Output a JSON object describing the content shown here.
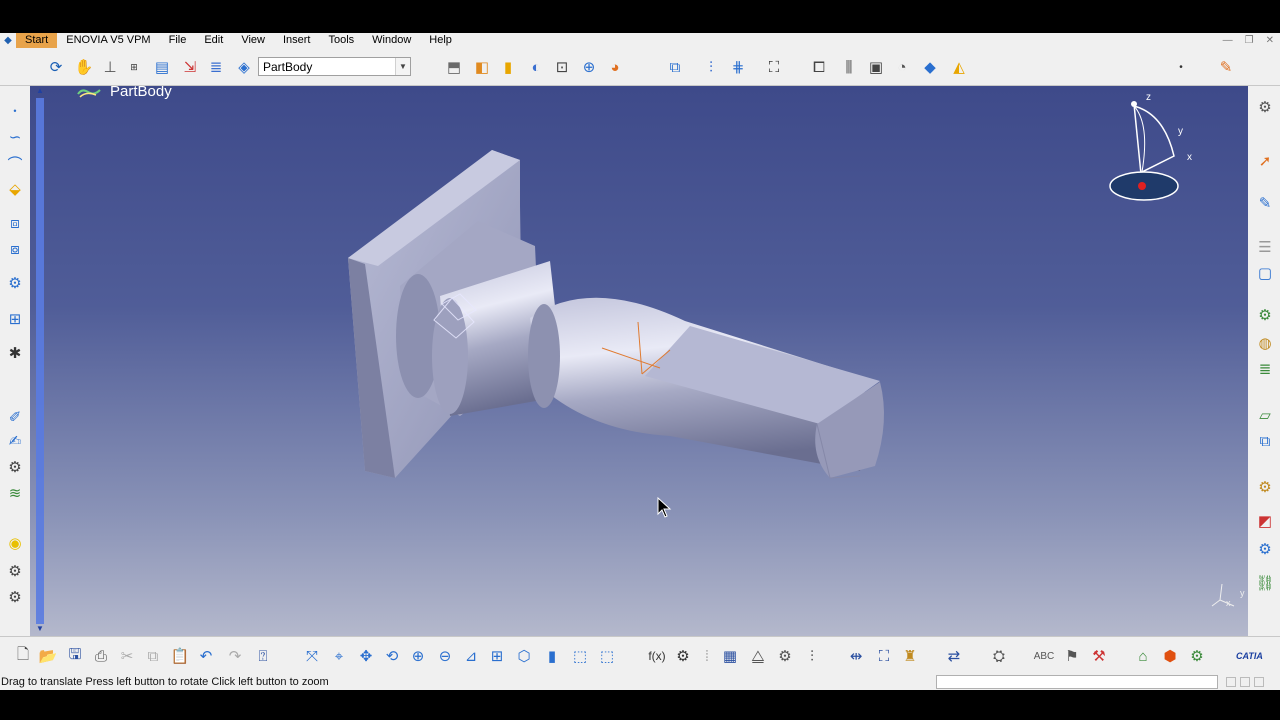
{
  "menu": {
    "items": [
      "Start",
      "ENOVIA V5 VPM",
      "File",
      "Edit",
      "View",
      "Insert",
      "Tools",
      "Window",
      "Help"
    ]
  },
  "toolbar": {
    "body_select_value": "PartBody"
  },
  "viewport": {
    "tree_root_label": "PartBody",
    "compass": {
      "z": "z",
      "y": "y",
      "x": "x"
    },
    "axis_small": {
      "x": "x",
      "y": "y"
    }
  },
  "status": {
    "text": "Drag to translate  Press left button to rotate  Click left button to zoom"
  },
  "branding": {
    "logo": "CATIA"
  },
  "colors": {
    "accent": "#e8a34a",
    "viewport_top": "#3e4a8a",
    "viewport_bottom": "#b4b8cc",
    "part": "#a7aac6"
  }
}
